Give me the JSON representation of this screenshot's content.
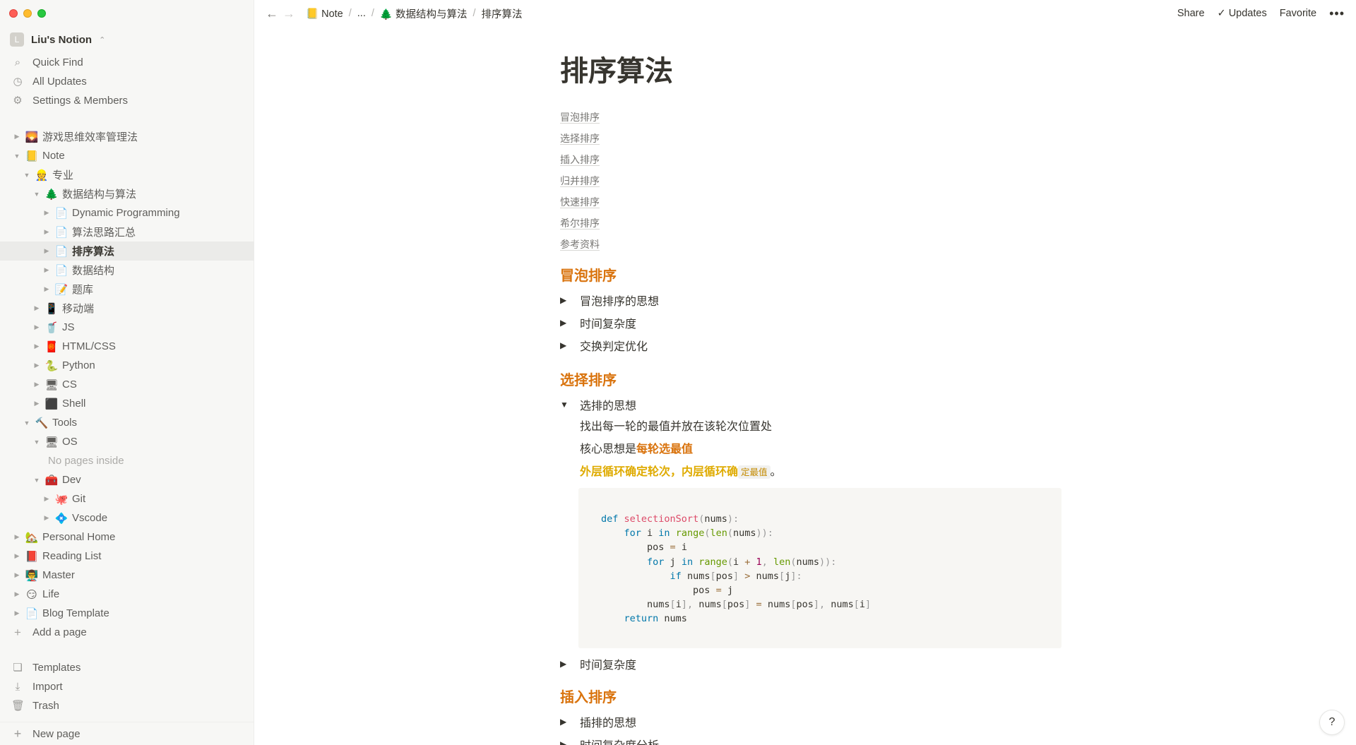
{
  "workspace": {
    "avatar": "L",
    "name": "Liu's Notion",
    "switch": "⌃"
  },
  "sidebar_actions": [
    {
      "label": "Quick Find",
      "icon": "search-icon",
      "glyph": "⌕"
    },
    {
      "label": "All Updates",
      "icon": "clock-icon",
      "glyph": "◷"
    },
    {
      "label": "Settings & Members",
      "icon": "gear-icon",
      "glyph": "⚙"
    }
  ],
  "tree": [
    {
      "label": "游戏思维效率管理法",
      "emoji": "🌄",
      "toggle": "▶"
    },
    {
      "label": "Note",
      "emoji": "📒",
      "toggle": "▼"
    },
    {
      "label": "专业",
      "emoji": "👷",
      "toggle": "▼"
    },
    {
      "label": "数据结构与算法",
      "emoji": "🌲",
      "toggle": "▼"
    },
    {
      "label": "Dynamic Programming",
      "emoji": "📄",
      "toggle": "▶"
    },
    {
      "label": "算法思路汇总",
      "emoji": "📄",
      "toggle": "▶"
    },
    {
      "label": "排序算法",
      "emoji": "📄",
      "toggle": "▶"
    },
    {
      "label": "数据结构",
      "emoji": "📄",
      "toggle": "▶"
    },
    {
      "label": "题库",
      "emoji": "📝",
      "toggle": "▶"
    },
    {
      "label": "移动端",
      "emoji": "📱",
      "toggle": "▶"
    },
    {
      "label": "JS",
      "emoji": "🥤",
      "toggle": "▶"
    },
    {
      "label": "HTML/CSS",
      "emoji": "🧧",
      "toggle": "▶"
    },
    {
      "label": "Python",
      "emoji": "🐍",
      "toggle": "▶"
    },
    {
      "label": "CS",
      "emoji": "🖥",
      "toggle": "▶"
    },
    {
      "label": "Shell",
      "emoji": "⬛",
      "toggle": "▶"
    },
    {
      "label": "Tools",
      "emoji": "🔨",
      "toggle": "▼"
    },
    {
      "label": "OS",
      "emoji": "🖥",
      "toggle": "▼"
    },
    {
      "label": "No pages inside",
      "emoji": "",
      "toggle": ""
    },
    {
      "label": "Dev",
      "emoji": "🧰",
      "toggle": "▼"
    },
    {
      "label": "Git",
      "emoji": "🐙",
      "toggle": "▶"
    },
    {
      "label": "Vscode",
      "emoji": "💠",
      "toggle": "▶"
    },
    {
      "label": "Personal Home",
      "emoji": "🏡",
      "toggle": "▶"
    },
    {
      "label": "Reading List",
      "emoji": "📕",
      "toggle": "▶"
    },
    {
      "label": "Master",
      "emoji": "👨‍🏫",
      "toggle": "▶"
    },
    {
      "label": "Life",
      "emoji": "😏",
      "toggle": "▶"
    },
    {
      "label": "Blog Template",
      "emoji": "📄",
      "toggle": "▶"
    }
  ],
  "add_page": {
    "label": "Add a page",
    "glyph": "+"
  },
  "bottom_actions": [
    {
      "label": "Templates",
      "icon": "templates-icon",
      "glyph": "❏"
    },
    {
      "label": "Import",
      "icon": "import-icon",
      "glyph": "⤓"
    },
    {
      "label": "Trash",
      "icon": "trash-icon",
      "glyph": "🗑"
    }
  ],
  "new_page": {
    "label": "New page",
    "glyph": "+"
  },
  "topbar": {
    "back": "←",
    "forward": "→",
    "breadcrumb": [
      {
        "emoji": "📒",
        "label": "Note"
      },
      {
        "emoji": "",
        "label": "..."
      },
      {
        "emoji": "🌲",
        "label": "数据结构与算法"
      },
      {
        "emoji": "",
        "label": "排序算法"
      }
    ],
    "separator": "/",
    "share": "Share",
    "updates_check": "✓",
    "updates": "Updates",
    "favorite": "Favorite",
    "more": "•••"
  },
  "page": {
    "title": "排序算法",
    "toc": [
      "冒泡排序",
      "选择排序",
      "插入排序",
      "归并排序",
      "快速排序",
      "希尔排序",
      "参考资料"
    ],
    "sections": {
      "bubble": {
        "heading": "冒泡排序",
        "toggles": [
          "冒泡排序的思想",
          "时间复杂度",
          "交换判定优化"
        ]
      },
      "selection": {
        "heading": "选择排序",
        "open_toggle": "选排的思想",
        "line1": "找出每一轮的最值并放在该轮次位置处",
        "line2_prefix": "核心思想是",
        "line2_highlight": "每轮选最值",
        "line3_highlight": "外层循环确定轮次，内层循环确",
        "line3_code": "定最值",
        "line3_suffix": "。",
        "after_toggle": "时间复杂度"
      },
      "insertion": {
        "heading": "插入排序",
        "toggles": [
          "插排的思想",
          "时间复杂度分析"
        ]
      }
    },
    "toggle_closed": "▶",
    "toggle_open": "▼"
  },
  "help": "?"
}
